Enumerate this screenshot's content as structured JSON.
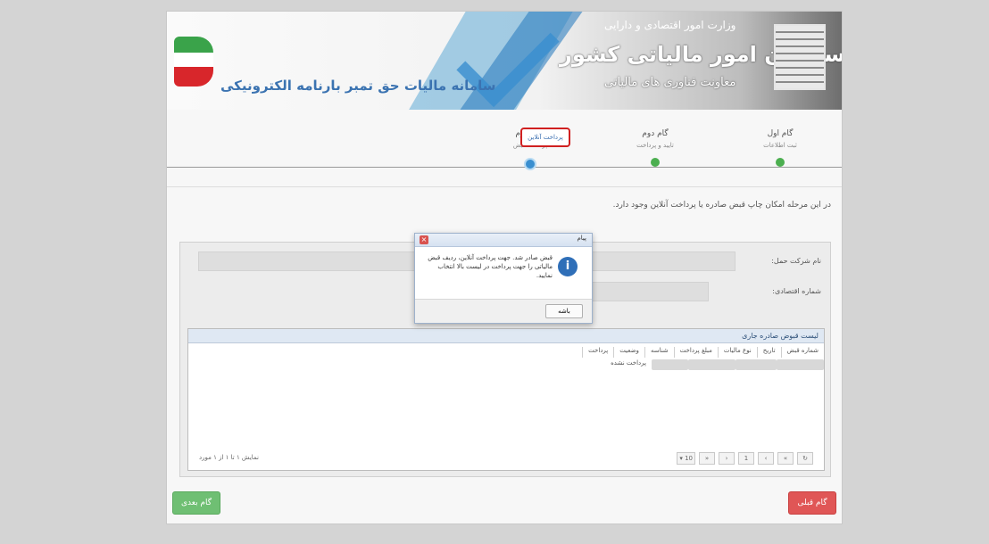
{
  "header": {
    "system_title": "سامانه مالیات حق تمبر بارنامه الکترونیکی",
    "ministry": "وزارت امور اقتصادی و دارایی",
    "org_title": "سازمان امور مالیاتی کشور",
    "deputy": "معاونت فناوری های مالیاتی"
  },
  "steps": [
    {
      "title": "گام اول",
      "subtitle": "ثبت اطلاعات",
      "status": "done"
    },
    {
      "title": "گام دوم",
      "subtitle": "تایید و پرداخت",
      "status": "done"
    },
    {
      "title": "گام سوم",
      "subtitle": "پرداخت قبض",
      "status": "current"
    }
  ],
  "notice": "در این مرحله امکان چاپ قبض صادره یا پرداخت آنلاین وجود دارد.",
  "form": {
    "company_label": "نام شرکت حمل:",
    "national_id_label": "شماره اقتصادی:"
  },
  "grid": {
    "title": "لیست قبوض صادره جاری",
    "columns": [
      "شماره قبض",
      "تاریخ",
      "نوع مالیات",
      "مبلغ پرداخت",
      "شناسه",
      "وضعیت",
      "پرداخت"
    ],
    "row": {
      "status": "پرداخت نشده",
      "pay_link": "پرداخت آنلاین"
    },
    "pager_info": "نمایش ۱ تا ۱ از ۱ مورد"
  },
  "dialog": {
    "title": "پیام",
    "message": "قبض صادر شد. جهت پرداخت آنلاین، ردیف قبض مالیاتی را جهت پرداخت در لیست بالا انتخاب نمایید.",
    "ok_label": "باشه"
  },
  "buttons": {
    "next": "گام بعدی",
    "prev": "گام قبلی"
  },
  "colors": {
    "step_done": "#4caf50",
    "step_current": "#3a8fd0",
    "highlight": "#d02020"
  }
}
